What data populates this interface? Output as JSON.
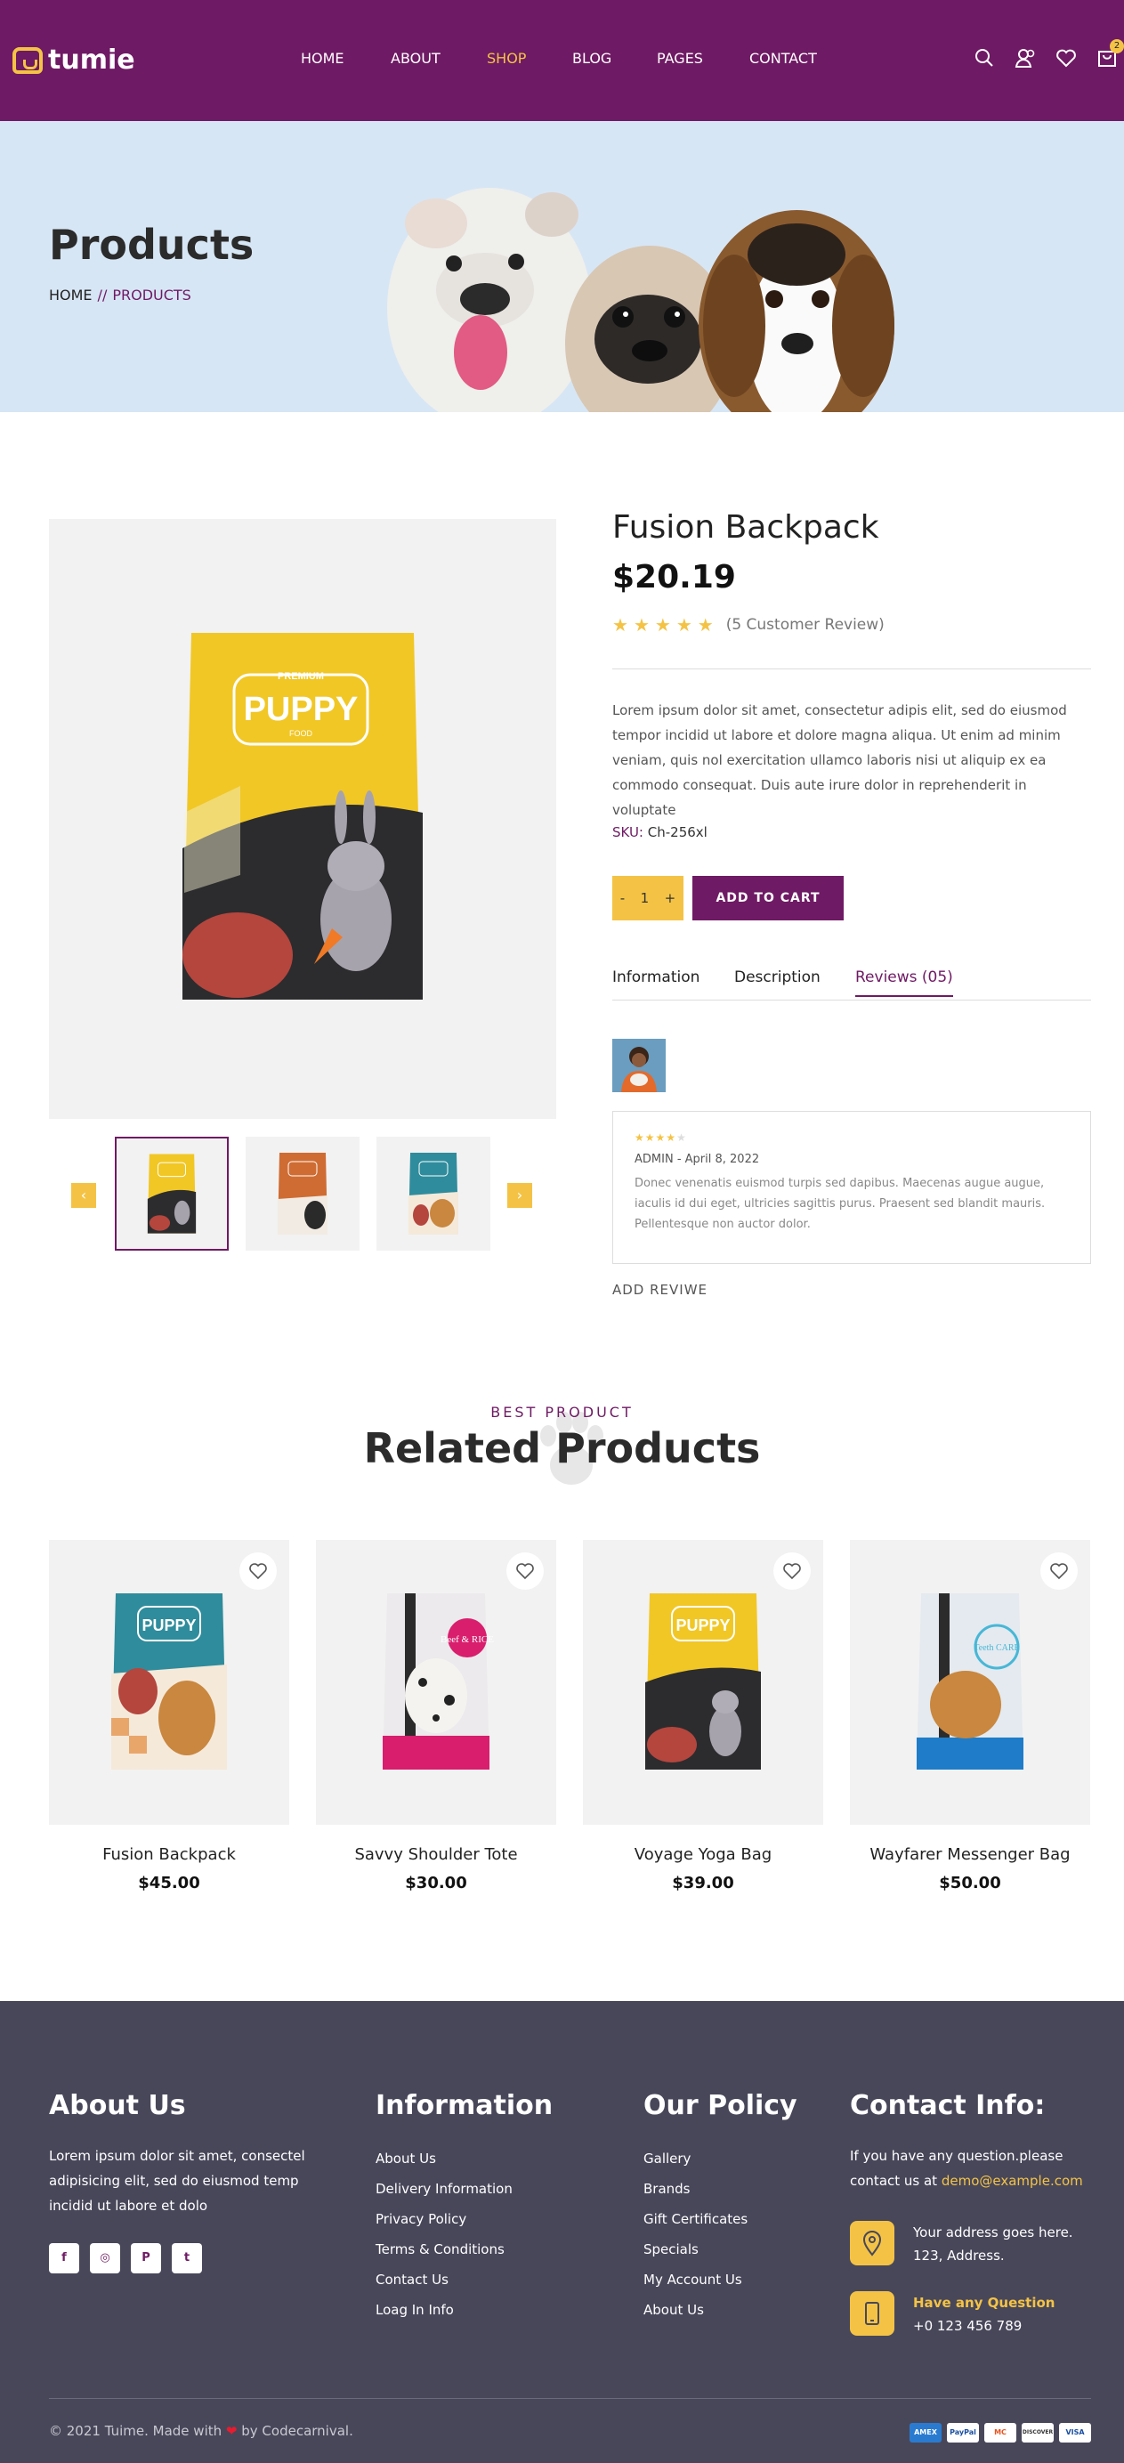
{
  "header": {
    "logo": "tumie",
    "nav": [
      "HOME",
      "ABOUT",
      "SHOP",
      "BLOG",
      "PAGES",
      "CONTACT"
    ],
    "active_nav": "SHOP",
    "cart_count": "2"
  },
  "banner": {
    "title": "Products",
    "crumb_home": "HOME",
    "crumb_sep": "//",
    "crumb_current": "PRODUCTS"
  },
  "product": {
    "title": "Fusion Backpack",
    "price": "$20.19",
    "rating": 5,
    "review_count_text": "(5 Customer Review)",
    "description": "Lorem ipsum dolor sit amet, consectetur adipis elit, sed do eiusmod tempor incidid ut labore et dolore magna aliqua. Ut enim ad minim veniam, quis nol exercitation ullamco laboris nisi ut aliquip ex ea commodo consequat. Duis aute irure dolor in reprehenderit in voluptate",
    "sku_label": "SKU:",
    "sku_value": "Ch-256xl",
    "qty_minus": "-",
    "qty_value": "1",
    "qty_plus": "+",
    "add_to_cart": "ADD TO CART",
    "image_brand": "PUPPY",
    "image_premium": "PREMIUM",
    "image_food": "FOOD"
  },
  "tabs": [
    "Information",
    "Description",
    "Reviews (05)"
  ],
  "active_tab": "Reviews (05)",
  "review": {
    "rating": 4,
    "author": "ADMIN",
    "date": " - April 8, 2022",
    "text": "Donec venenatis euismod turpis sed dapibus. Maecenas augue augue, iaculis id dui eget, ultricies sagittis purus. Praesent sed blandit mauris. Pellentesque non auctor dolor."
  },
  "add_review": "ADD REVIWE",
  "related": {
    "subtitle": "BEST PRODUCT",
    "title": "Related Products",
    "items": [
      {
        "name": "Fusion Backpack",
        "price": "$45.00",
        "color": "#2f8c9c",
        "tag": "PUPPY"
      },
      {
        "name": "Savvy Shoulder Tote",
        "price": "$30.00",
        "color": "#e9e6ea",
        "tag": "Beef & RICE"
      },
      {
        "name": "Voyage Yoga Bag",
        "price": "$39.00",
        "color": "#f2c82b",
        "tag": "PUPPY"
      },
      {
        "name": "Wayfarer Messenger Bag",
        "price": "$50.00",
        "color": "#dfe4ea",
        "tag": "Teeth CARE"
      }
    ]
  },
  "footer": {
    "about_title": "About Us",
    "about_text": "Lorem ipsum dolor sit amet, consectel adipisicing elit, sed do eiusmod temp incidid ut labore et dolo",
    "social": [
      "f",
      "◎",
      "P",
      "t"
    ],
    "info_title": "Information",
    "info_links": [
      "About Us",
      "Delivery Information",
      "Privacy Policy",
      "Terms & Conditions",
      "Contact Us",
      "Loag In Info"
    ],
    "policy_title": "Our Policy",
    "policy_links": [
      "Gallery",
      "Brands",
      "Gift Certificates",
      "Specials",
      "My Account Us",
      "About Us"
    ],
    "contact_title": "Contact Info:",
    "contact_text": "If you have any question.please contact us at ",
    "contact_email": "demo@example.com",
    "address_1": "Your address goes here.",
    "address_2": "123, Address.",
    "question_label": "Have any Question",
    "phone": "+0 123 456 789",
    "copyright": "© 2021 Tuime. Made with",
    "copyright_by": "by Codecarnival.",
    "payments": [
      "VISA",
      "DISCOVER",
      "MC",
      "PayPal",
      "AMEX"
    ]
  },
  "colors": {
    "brand": "#6f1a64",
    "accent": "#f4c345",
    "footer": "#48475a"
  }
}
